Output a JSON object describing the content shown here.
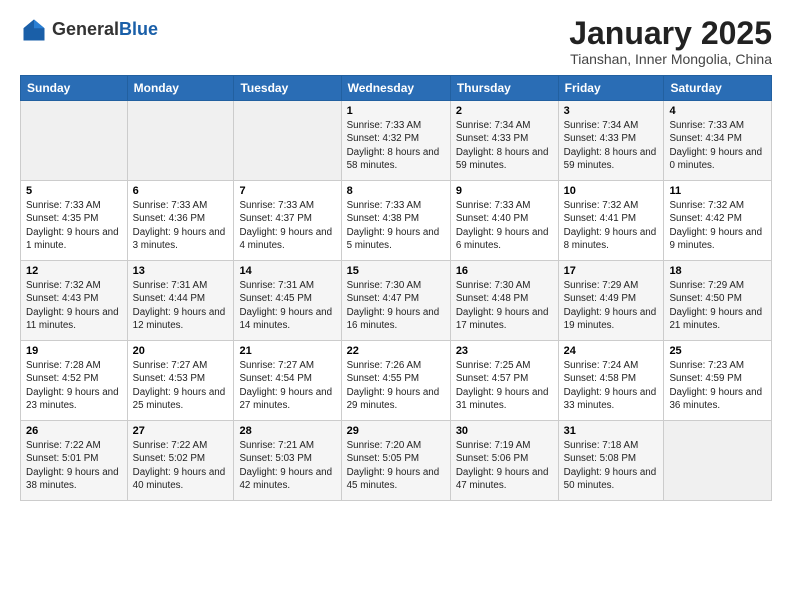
{
  "logo": {
    "general": "General",
    "blue": "Blue"
  },
  "header": {
    "title": "January 2025",
    "location": "Tianshan, Inner Mongolia, China"
  },
  "days_of_week": [
    "Sunday",
    "Monday",
    "Tuesday",
    "Wednesday",
    "Thursday",
    "Friday",
    "Saturday"
  ],
  "weeks": [
    [
      {
        "num": "",
        "info": ""
      },
      {
        "num": "",
        "info": ""
      },
      {
        "num": "",
        "info": ""
      },
      {
        "num": "1",
        "info": "Sunrise: 7:33 AM\nSunset: 4:32 PM\nDaylight: 8 hours and 58 minutes."
      },
      {
        "num": "2",
        "info": "Sunrise: 7:34 AM\nSunset: 4:33 PM\nDaylight: 8 hours and 59 minutes."
      },
      {
        "num": "3",
        "info": "Sunrise: 7:34 AM\nSunset: 4:33 PM\nDaylight: 8 hours and 59 minutes."
      },
      {
        "num": "4",
        "info": "Sunrise: 7:33 AM\nSunset: 4:34 PM\nDaylight: 9 hours and 0 minutes."
      }
    ],
    [
      {
        "num": "5",
        "info": "Sunrise: 7:33 AM\nSunset: 4:35 PM\nDaylight: 9 hours and 1 minute."
      },
      {
        "num": "6",
        "info": "Sunrise: 7:33 AM\nSunset: 4:36 PM\nDaylight: 9 hours and 3 minutes."
      },
      {
        "num": "7",
        "info": "Sunrise: 7:33 AM\nSunset: 4:37 PM\nDaylight: 9 hours and 4 minutes."
      },
      {
        "num": "8",
        "info": "Sunrise: 7:33 AM\nSunset: 4:38 PM\nDaylight: 9 hours and 5 minutes."
      },
      {
        "num": "9",
        "info": "Sunrise: 7:33 AM\nSunset: 4:40 PM\nDaylight: 9 hours and 6 minutes."
      },
      {
        "num": "10",
        "info": "Sunrise: 7:32 AM\nSunset: 4:41 PM\nDaylight: 9 hours and 8 minutes."
      },
      {
        "num": "11",
        "info": "Sunrise: 7:32 AM\nSunset: 4:42 PM\nDaylight: 9 hours and 9 minutes."
      }
    ],
    [
      {
        "num": "12",
        "info": "Sunrise: 7:32 AM\nSunset: 4:43 PM\nDaylight: 9 hours and 11 minutes."
      },
      {
        "num": "13",
        "info": "Sunrise: 7:31 AM\nSunset: 4:44 PM\nDaylight: 9 hours and 12 minutes."
      },
      {
        "num": "14",
        "info": "Sunrise: 7:31 AM\nSunset: 4:45 PM\nDaylight: 9 hours and 14 minutes."
      },
      {
        "num": "15",
        "info": "Sunrise: 7:30 AM\nSunset: 4:47 PM\nDaylight: 9 hours and 16 minutes."
      },
      {
        "num": "16",
        "info": "Sunrise: 7:30 AM\nSunset: 4:48 PM\nDaylight: 9 hours and 17 minutes."
      },
      {
        "num": "17",
        "info": "Sunrise: 7:29 AM\nSunset: 4:49 PM\nDaylight: 9 hours and 19 minutes."
      },
      {
        "num": "18",
        "info": "Sunrise: 7:29 AM\nSunset: 4:50 PM\nDaylight: 9 hours and 21 minutes."
      }
    ],
    [
      {
        "num": "19",
        "info": "Sunrise: 7:28 AM\nSunset: 4:52 PM\nDaylight: 9 hours and 23 minutes."
      },
      {
        "num": "20",
        "info": "Sunrise: 7:27 AM\nSunset: 4:53 PM\nDaylight: 9 hours and 25 minutes."
      },
      {
        "num": "21",
        "info": "Sunrise: 7:27 AM\nSunset: 4:54 PM\nDaylight: 9 hours and 27 minutes."
      },
      {
        "num": "22",
        "info": "Sunrise: 7:26 AM\nSunset: 4:55 PM\nDaylight: 9 hours and 29 minutes."
      },
      {
        "num": "23",
        "info": "Sunrise: 7:25 AM\nSunset: 4:57 PM\nDaylight: 9 hours and 31 minutes."
      },
      {
        "num": "24",
        "info": "Sunrise: 7:24 AM\nSunset: 4:58 PM\nDaylight: 9 hours and 33 minutes."
      },
      {
        "num": "25",
        "info": "Sunrise: 7:23 AM\nSunset: 4:59 PM\nDaylight: 9 hours and 36 minutes."
      }
    ],
    [
      {
        "num": "26",
        "info": "Sunrise: 7:22 AM\nSunset: 5:01 PM\nDaylight: 9 hours and 38 minutes."
      },
      {
        "num": "27",
        "info": "Sunrise: 7:22 AM\nSunset: 5:02 PM\nDaylight: 9 hours and 40 minutes."
      },
      {
        "num": "28",
        "info": "Sunrise: 7:21 AM\nSunset: 5:03 PM\nDaylight: 9 hours and 42 minutes."
      },
      {
        "num": "29",
        "info": "Sunrise: 7:20 AM\nSunset: 5:05 PM\nDaylight: 9 hours and 45 minutes."
      },
      {
        "num": "30",
        "info": "Sunrise: 7:19 AM\nSunset: 5:06 PM\nDaylight: 9 hours and 47 minutes."
      },
      {
        "num": "31",
        "info": "Sunrise: 7:18 AM\nSunset: 5:08 PM\nDaylight: 9 hours and 50 minutes."
      },
      {
        "num": "",
        "info": ""
      }
    ]
  ]
}
